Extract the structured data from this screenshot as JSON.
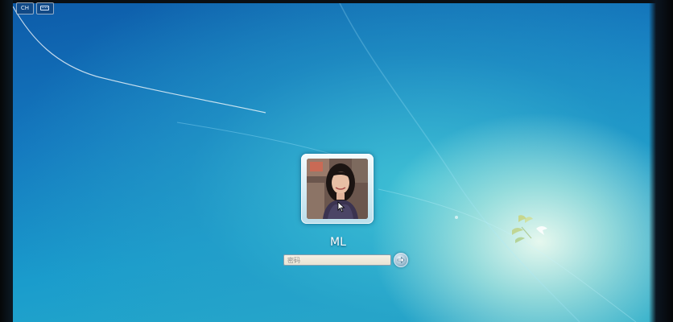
{
  "screen": {
    "type": "windows-logon",
    "background_colors": {
      "top": "#0d5aa8",
      "middle": "#1a9ccc",
      "glow": "#f0fcf0"
    }
  },
  "top_bar": {
    "language_indicator": "CH",
    "keyboard_icon": "keyboard-icon"
  },
  "user": {
    "name": "ML",
    "picture_icon": "user-photo"
  },
  "login": {
    "password_placeholder": "密码",
    "password_value": "",
    "submit_icon": "arrow-right-icon"
  },
  "decor": {
    "logo_icon": "bird-logo-icon",
    "cursor_icon": "mouse-pointer-icon"
  }
}
